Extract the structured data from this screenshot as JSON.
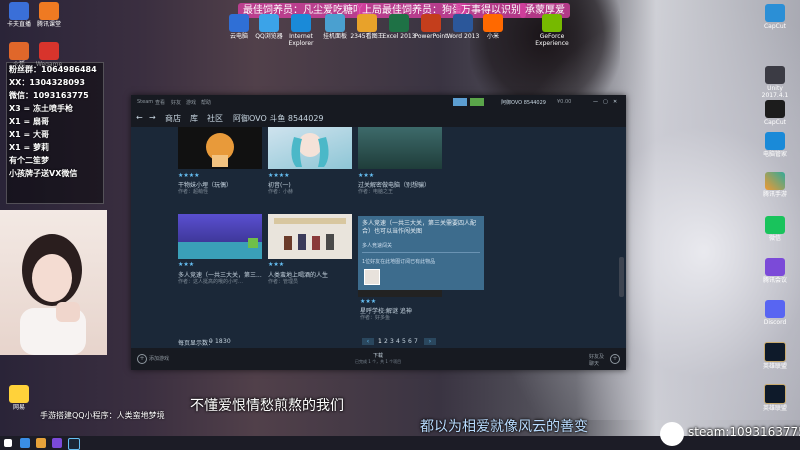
{
  "stream_banners": [
    "最佳饲养员：凡尘爱吃糖吖",
    "上局最佳饲养员：狗蛋",
    "万事得以识别",
    "承蒙厚爱"
  ],
  "desktop_top_labels": [
    "云电脑",
    "QQ浏览器",
    "Internet Explorer",
    "挂机面板",
    "2345看图王",
    "Excel 2013",
    "PowerPoint",
    "Word 2013",
    "小米",
    "GeForce Experience"
  ],
  "left_icon_labels": [
    "卡夫直播",
    "腾讯课堂",
    "火狐",
    "Wegame",
    "网易",
    "抖音",
    "直播伴侣",
    "WeGame"
  ],
  "right_icon_labels": [
    "CapCut",
    "剪映",
    "Unity 2017.4.1",
    "CapCut",
    "腾讯手游",
    "电脑管家",
    "微信",
    "腾讯会议",
    "Discord",
    "英雄联盟",
    "WeGame",
    "英雄联盟"
  ],
  "overlay": {
    "lines": [
      "粉丝群：1064986484",
      "XX：1304328093",
      "微信：1093163775",
      "X3 = 冻土喷手枪",
      "X1 = 扇哥",
      "X1 = 大哥",
      "X1 = 萝莉",
      "有个二笙梦",
      "小孩牌子送VX微信"
    ]
  },
  "steam": {
    "titlebar": {
      "menus": [
        "Steam",
        "查看",
        "好友",
        "游戏",
        "帮助"
      ],
      "user": "阿御OVO 8544029",
      "wallet": "¥0.00"
    },
    "nav": {
      "back_icon": "left-arrow-icon",
      "forward_icon": "right-arrow-icon",
      "items": [
        "商店",
        "库",
        "社区",
        "阿御OVO 斗鱼 8544029"
      ]
    },
    "items_row1": [
      {
        "title": "干物妹小埋（玩偶）",
        "author": "作者：超萌怪",
        "rating": "★★★★"
      },
      {
        "title": "初音(一)",
        "author": "作者：小赫",
        "rating": "★★★★"
      },
      {
        "title": "过关解密做电脑（别想骗）",
        "author": "作者：电脑之王",
        "rating": "★★★"
      }
    ],
    "items_row2": [
      {
        "title": "多人竞速（一共三大关，第三...",
        "author": "作者：这人挺高的哦的小可…",
        "rating": "★★★"
      },
      {
        "title": "人类蛮地上喝酒的人生",
        "author": "作者：管理员",
        "rating": "★★★"
      },
      {
        "title": "星呼学校:解谜 追神",
        "author": "作者：好多鱼",
        "rating": "★★★"
      }
    ],
    "tooltip": {
      "title": "多人竞速（一共三大关，第三关需要四人配合）也可以当作闯关图",
      "tag": "多人竞速闯关",
      "note": "1位好友在此地图订阅已有此物品"
    },
    "per_page_label": "每页显示数：",
    "per_page_values": [
      "9",
      "18",
      "30"
    ],
    "pages": [
      "1",
      "2",
      "3",
      "4",
      "5",
      "6",
      "7"
    ],
    "footer": {
      "add_game": "添加游戏",
      "downloads_title": "下载",
      "downloads_sub": "已完成 1 个，共 1 个项目",
      "friends": "好友及\n聊天"
    }
  },
  "subtitles": {
    "left": "不懂爱恨情愁煎熬的我们",
    "right": "都以为相爱就像风云的善变",
    "steam_id": "steam:1093163775",
    "qq_note": "手游搭建QQ小程序：人类蛮地梦境"
  }
}
